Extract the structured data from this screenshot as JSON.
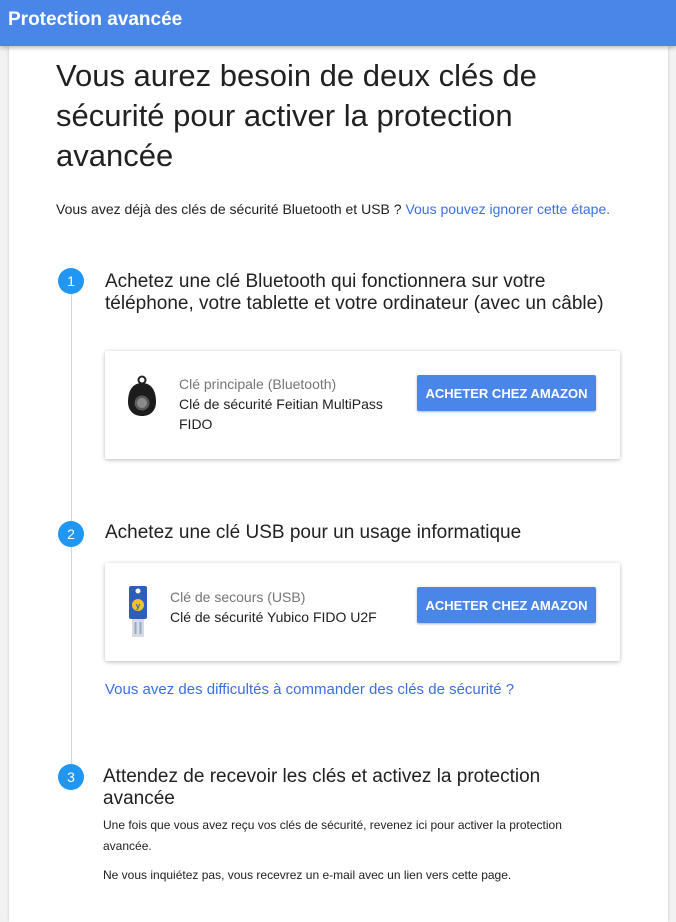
{
  "header": {
    "title": "Protection avancée"
  },
  "main": {
    "headline": "Vous aurez besoin de deux clés de sécurité pour activer la protection avancée",
    "intro_text": "Vous avez déjà des clés de sécurité Bluetooth et USB ? ",
    "intro_link": "Vous pouvez ignorer cette étape."
  },
  "steps": [
    {
      "number": "1",
      "title": "Achetez une clé Bluetooth qui fonctionnera sur votre téléphone, votre tablette et votre ordinateur (avec un câble)",
      "card": {
        "icon": "bluetooth-key-icon",
        "label": "Clé principale (Bluetooth)",
        "name": "Clé de sécurité Feitian MultiPass FIDO",
        "button": "ACHETER CHEZ AMAZON"
      }
    },
    {
      "number": "2",
      "title": "Achetez une clé USB pour un usage informatique",
      "card": {
        "icon": "usb-key-icon",
        "label": "Clé de secours (USB)",
        "name": "Clé de sécurité Yubico FIDO U2F",
        "button": "ACHETER CHEZ AMAZON"
      },
      "help_link": "Vous avez des difficultés à commander des clés de sécurité ?"
    },
    {
      "number": "3",
      "title": "Attendez de recevoir les clés et activez la protection avancée",
      "paragraph1": "Une fois que vous avez reçu vos clés de sécurité, revenez ici pour activer la protection avancée.",
      "paragraph2": "Ne vous inquiétez pas, vous recevrez un e-mail avec un lien vers cette page."
    }
  ],
  "colors": {
    "header_bg": "#4a86e8",
    "accent": "#2196f3",
    "button_bg": "#4a86e8",
    "link": "#3a6fe0"
  }
}
